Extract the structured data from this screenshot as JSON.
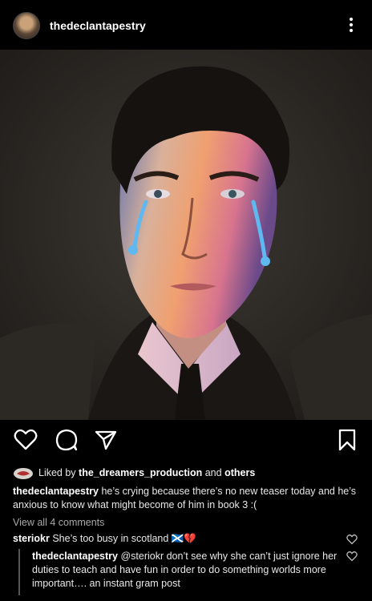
{
  "post": {
    "username": "thedeclantapestry",
    "more_icon": "more-vertical-icon"
  },
  "actions": {
    "like_icon": "heart-icon",
    "comment_icon": "comment-icon",
    "share_icon": "send-icon",
    "save_icon": "bookmark-icon"
  },
  "likes": {
    "prefix": "Liked by ",
    "user": "the_dreamers_production",
    "middle": " and ",
    "others": "others"
  },
  "caption": {
    "username": "thedeclantapestry",
    "text": " he’s crying because there’s no new teaser today and he’s anxious to know what might become of him in book 3 :("
  },
  "view_all_comments": "View all 4 comments",
  "comments": [
    {
      "username": "steriokr",
      "text": " She’s too busy in scotland 🏴󠁧󠁢󠁳󠁣󠁴󠁿💔"
    },
    {
      "username": "thedeclantapestry",
      "text": " @steriokr don’t see why she can’t just ignore her duties to teach and have fun in order to do something worlds more important…. an instant gram post"
    }
  ],
  "colors": {
    "background": "#000000",
    "text": "#f5f5f5",
    "muted": "#a8a8a8",
    "tear": "#5fb8f0"
  }
}
